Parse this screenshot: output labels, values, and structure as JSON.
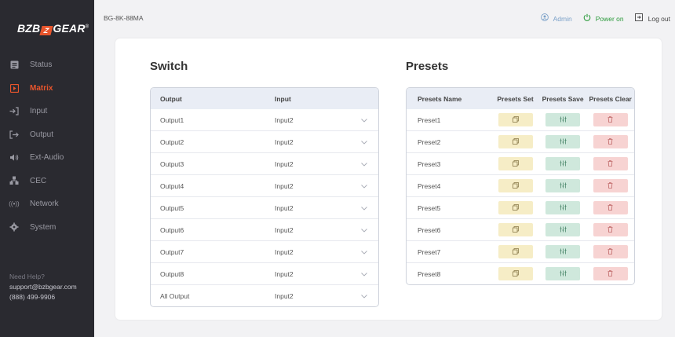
{
  "sidebar": {
    "logo_text_left": "BZB",
    "logo_text_right": "GEAR",
    "logo_reg": "®",
    "items": [
      {
        "label": "Status",
        "icon": "status-icon",
        "active": false
      },
      {
        "label": "Matrix",
        "icon": "matrix-icon",
        "active": true
      },
      {
        "label": "Input",
        "icon": "input-icon",
        "active": false
      },
      {
        "label": "Output",
        "icon": "output-icon",
        "active": false
      },
      {
        "label": "Ext-Audio",
        "icon": "speaker-icon",
        "active": false
      },
      {
        "label": "CEC",
        "icon": "cec-icon",
        "active": false
      },
      {
        "label": "Network",
        "icon": "network-icon",
        "active": false
      },
      {
        "label": "System",
        "icon": "gear-icon",
        "active": false
      }
    ],
    "help_title": "Need Help?",
    "help_email": "support@bzbgear.com",
    "help_phone": "(888) 499-9906"
  },
  "header": {
    "device": "BG-8K-88MA",
    "admin_label": "Admin",
    "power_label": "Power on",
    "logout_label": "Log out"
  },
  "switch": {
    "title": "Switch",
    "col_output": "Output",
    "col_input": "Input",
    "rows": [
      {
        "output": "Output1",
        "input": "Input2"
      },
      {
        "output": "Output2",
        "input": "Input2"
      },
      {
        "output": "Output3",
        "input": "Input2"
      },
      {
        "output": "Output4",
        "input": "Input2"
      },
      {
        "output": "Output5",
        "input": "Input2"
      },
      {
        "output": "Output6",
        "input": "Input2"
      },
      {
        "output": "Output7",
        "input": "Input2"
      },
      {
        "output": "Output8",
        "input": "Input2"
      },
      {
        "output": "All Output",
        "input": "Input2"
      }
    ]
  },
  "presets": {
    "title": "Presets",
    "col_name": "Presets Name",
    "col_set": "Presets Set",
    "col_save": "Presets Save",
    "col_clear": "Presets Clear",
    "rows": [
      "Preset1",
      "Preset2",
      "Preset3",
      "Preset4",
      "Preset5",
      "Preset6",
      "Preset7",
      "Preset8"
    ]
  },
  "colors": {
    "accent": "#e8552c",
    "sidebar_bg": "#2a2a30",
    "power_green": "#2a9a3a",
    "set_bg": "#f6edc6",
    "save_bg": "#cfe8dc",
    "clear_bg": "#f7d3d2"
  }
}
